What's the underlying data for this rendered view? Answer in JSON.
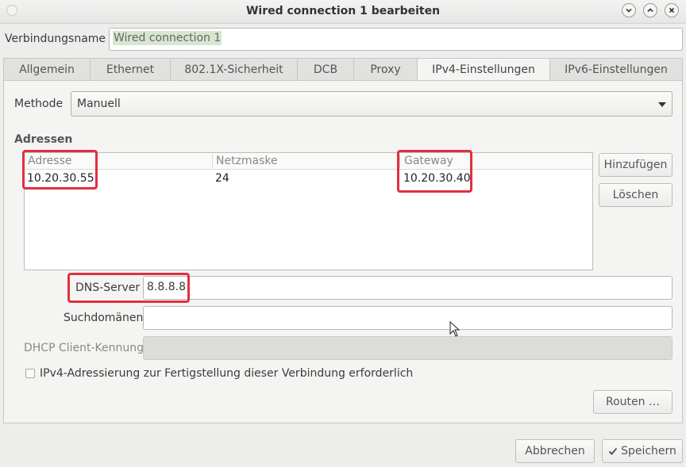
{
  "window": {
    "title": "Wired connection 1 bearbeiten"
  },
  "connection": {
    "name_label": "Verbindungsname",
    "name_value": "Wired connection 1"
  },
  "tabs": [
    {
      "label": "Allgemein",
      "active": false
    },
    {
      "label": "Ethernet",
      "active": false
    },
    {
      "label": "802.1X-Sicherheit",
      "active": false
    },
    {
      "label": "DCB",
      "active": false
    },
    {
      "label": "Proxy",
      "active": false
    },
    {
      "label": "IPv4-Einstellungen",
      "active": true
    },
    {
      "label": "IPv6-Einstellungen",
      "active": false
    }
  ],
  "ipv4": {
    "method_label": "Methode",
    "method_value": "Manuell",
    "addresses_label": "Adressen",
    "columns": [
      "Adresse",
      "Netzmaske",
      "Gateway"
    ],
    "rows": [
      {
        "address": "10.20.30.55",
        "netmask": "24",
        "gateway": "10.20.30.40"
      }
    ],
    "add_button": "Hinzufügen",
    "delete_button": "Löschen",
    "dns_label": "DNS-Server",
    "dns_value": "8.8.8.8",
    "search_label": "Suchdomänen",
    "search_value": "",
    "dhcp_label": "DHCP Client-Kennung",
    "dhcp_value": "",
    "require_checkbox_label": "IPv4-Adressierung zur Fertigstellung dieser Verbindung erforderlich",
    "require_checked": false,
    "routes_button": "Routen …"
  },
  "footer": {
    "cancel_button": "Abbrechen",
    "save_button": "Speichern"
  },
  "colors": {
    "highlight": "#e03040",
    "selection": "#d7e6cf"
  }
}
